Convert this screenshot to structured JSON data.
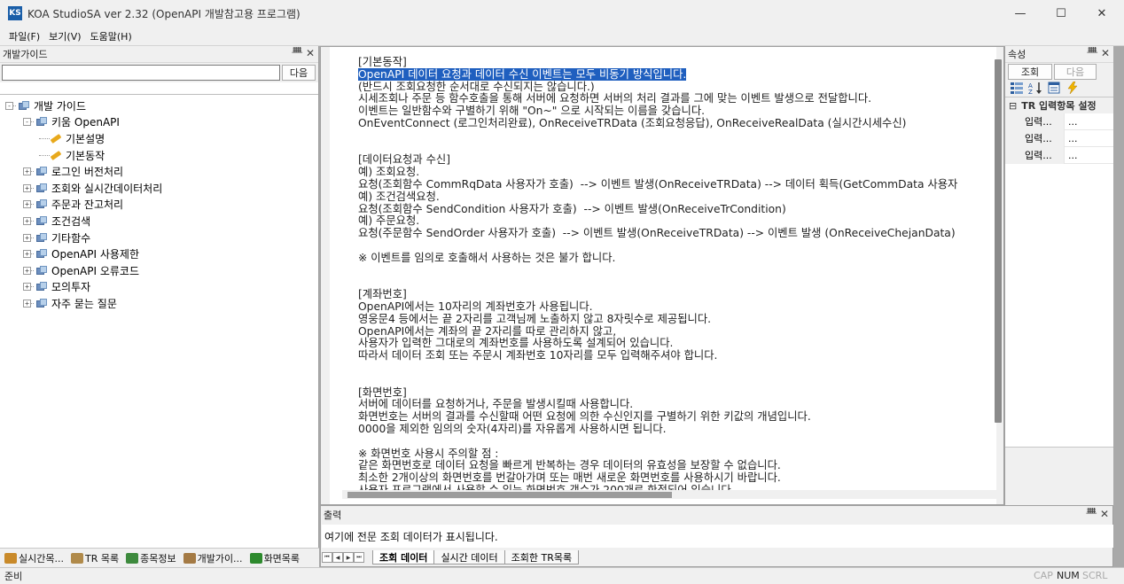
{
  "window": {
    "icon_text": "KS",
    "title": "KOA StudioSA ver 2.32  (OpenAPI 개발참고용 프로그램)",
    "minimize_glyph": "—",
    "maximize_glyph": "☐",
    "close_glyph": "✕"
  },
  "menu": {
    "items": [
      "파일(F)",
      "보기(V)",
      "도움말(H)"
    ]
  },
  "left_panel": {
    "title": "개발가이드",
    "pin_glyph": "ᚙ",
    "close_glyph": "✕",
    "search_value": "",
    "next_label": "다음",
    "tree": [
      {
        "label": "개발 가이드",
        "level": 0,
        "expander": "-",
        "icon": "folder"
      },
      {
        "label": "키움 OpenAPI",
        "level": 1,
        "expander": "-",
        "icon": "folder"
      },
      {
        "label": "기본설명",
        "level": 2,
        "expander": "",
        "icon": "doc"
      },
      {
        "label": "기본동작",
        "level": 2,
        "expander": "",
        "icon": "doc"
      },
      {
        "label": "로그인 버전처리",
        "level": 1,
        "expander": "+",
        "icon": "folder"
      },
      {
        "label": "조회와 실시간데이터처리",
        "level": 1,
        "expander": "+",
        "icon": "folder"
      },
      {
        "label": "주문과 잔고처리",
        "level": 1,
        "expander": "+",
        "icon": "folder"
      },
      {
        "label": "조건검색",
        "level": 1,
        "expander": "+",
        "icon": "folder"
      },
      {
        "label": "기타함수",
        "level": 1,
        "expander": "+",
        "icon": "folder"
      },
      {
        "label": "OpenAPI 사용제한",
        "level": 1,
        "expander": "+",
        "icon": "folder"
      },
      {
        "label": "OpenAPI 오류코드",
        "level": 1,
        "expander": "+",
        "icon": "folder"
      },
      {
        "label": "모의투자",
        "level": 1,
        "expander": "+",
        "icon": "folder"
      },
      {
        "label": "자주 묻는 질문",
        "level": 1,
        "expander": "+",
        "icon": "folder"
      }
    ],
    "bottom_tabs": [
      {
        "label": "실시간목...",
        "color": "#c98a2a"
      },
      {
        "label": "TR 목록",
        "color": "#b08a4a"
      },
      {
        "label": "종목정보",
        "color": "#3d8a3d"
      },
      {
        "label": "개발가이...",
        "color": "#a47a44"
      },
      {
        "label": "화면목록",
        "color": "#2d8a2d"
      }
    ]
  },
  "document": {
    "lines": [
      {
        "text": "[기본동작]",
        "highlight": false
      },
      {
        "text": "OpenAPI 데이터 요청과 데이터 수신 이벤트는 모두 비동기 방식입니다.",
        "highlight": true
      },
      {
        "text": "(반드시 조회요청한 순서대로 수신되지는 않습니다.)",
        "highlight": false
      },
      {
        "text": "시세조회나 주문 등 함수호출을 통해 서버에 요청하면 서버의 처리 결과를 그에 맞는 이벤트 발생으로 전달합니다.",
        "highlight": false
      },
      {
        "text": "이벤트는 일반함수와 구별하기 위해 \"On~\" 으로 시작되는 이름을 갖습니다.",
        "highlight": false
      },
      {
        "text": "OnEventConnect (로그인처리완료), OnReceiveTRData (조회요청응답), OnReceiveRealData (실시간시세수신)",
        "highlight": false
      },
      {
        "text": "",
        "highlight": false
      },
      {
        "text": "",
        "highlight": false
      },
      {
        "text": "[데이터요청과 수신]",
        "highlight": false
      },
      {
        "text": "예) 조회요청.",
        "highlight": false
      },
      {
        "text": "요청(조회함수 CommRqData 사용자가 호출)  --> 이벤트 발생(OnReceiveTRData) --> 데이터 획득(GetCommData 사용자",
        "highlight": false
      },
      {
        "text": "예) 조건검색요청.",
        "highlight": false
      },
      {
        "text": "요청(조회함수 SendCondition 사용자가 호출)  --> 이벤트 발생(OnReceiveTrCondition)",
        "highlight": false
      },
      {
        "text": "예) 주문요청.",
        "highlight": false
      },
      {
        "text": "요청(주문함수 SendOrder 사용자가 호출)  --> 이벤트 발생(OnReceiveTRData) --> 이벤트 발생 (OnReceiveChejanData)",
        "highlight": false
      },
      {
        "text": "",
        "highlight": false
      },
      {
        "text": "※ 이벤트를 임의로 호출해서 사용하는 것은 불가 합니다.",
        "highlight": false
      },
      {
        "text": "",
        "highlight": false
      },
      {
        "text": "",
        "highlight": false
      },
      {
        "text": "[계좌번호]",
        "highlight": false
      },
      {
        "text": "OpenAPI에서는 10자리의 계좌번호가 사용됩니다.",
        "highlight": false
      },
      {
        "text": "영웅문4 등에서는 끝 2자리를 고객님께 노출하지 않고 8자릿수로 제공됩니다.",
        "highlight": false
      },
      {
        "text": "OpenAPI에서는 계좌의 끝 2자리를 따로 관리하지 않고,",
        "highlight": false
      },
      {
        "text": "사용자가 입력한 그대로의 계좌번호를 사용하도록 설계되어 있습니다.",
        "highlight": false
      },
      {
        "text": "따라서 데이터 조회 또는 주문시 계좌번호 10자리를 모두 입력해주셔야 합니다.",
        "highlight": false
      },
      {
        "text": "",
        "highlight": false
      },
      {
        "text": "",
        "highlight": false
      },
      {
        "text": "[화면번호]",
        "highlight": false
      },
      {
        "text": "서버에 데이터를 요청하거나, 주문을 발생시킬때 사용합니다.",
        "highlight": false
      },
      {
        "text": "화면번호는 서버의 결과를 수신할때 어떤 요청에 의한 수신인지를 구별하기 위한 키값의 개념입니다.",
        "highlight": false
      },
      {
        "text": "0000을 제외한 임의의 숫자(4자리)를 자유롭게 사용하시면 됩니다.",
        "highlight": false
      },
      {
        "text": "",
        "highlight": false
      },
      {
        "text": "※ 화면번호 사용시 주의할 점 :",
        "highlight": false
      },
      {
        "text": "같은 화면번호로 데이터 요청을 빠르게 반복하는 경우 데이터의 유효성을 보장할 수 없습니다.",
        "highlight": false
      },
      {
        "text": "최소한 2개이상의 화면번호를 번갈아가며 또는 매번 새로운 화면번호를 사용하시기 바랍니다.",
        "highlight": false
      },
      {
        "text": "사용자 프로그램에서 사용할 수 있는 화면번호 갯수가 200개로 한정되어 있습니다.",
        "highlight": false
      }
    ]
  },
  "output": {
    "title": "출력",
    "pin_glyph": "ᚙ",
    "close_glyph": "✕",
    "text": "여기에 전문 조회 데이터가 표시됩니다.",
    "nav": [
      "⏮",
      "◀",
      "▶",
      "⏭"
    ],
    "tabs": [
      {
        "label": "조회 데이터",
        "active": true
      },
      {
        "label": "실시간 데이터",
        "active": false
      },
      {
        "label": "조회한 TR목록",
        "active": false
      }
    ]
  },
  "properties": {
    "title": "속성",
    "pin_glyph": "ᚙ",
    "close_glyph": "✕",
    "search_label": "조회",
    "next_label": "다음",
    "category": "TR 입력항목 설정",
    "category_expander": "⊟",
    "rows": [
      {
        "key": "입력...",
        "value": "..."
      },
      {
        "key": "입력...",
        "value": "..."
      },
      {
        "key": "입력...",
        "value": "..."
      }
    ]
  },
  "status": {
    "text": "준비",
    "cap": "CAP",
    "num": "NUM",
    "scrl": "SCRL"
  }
}
